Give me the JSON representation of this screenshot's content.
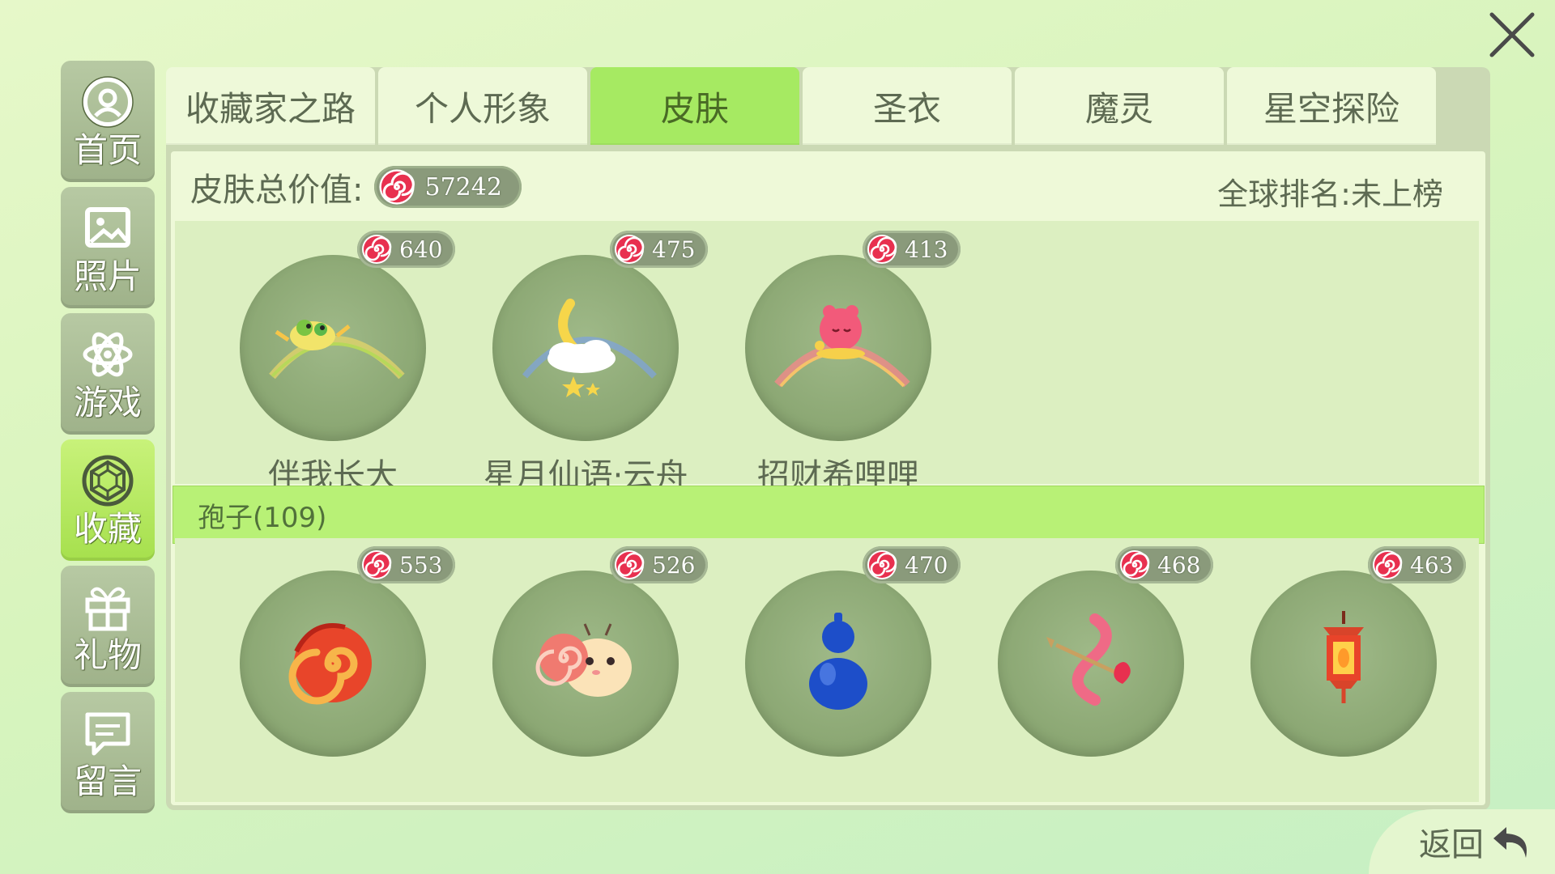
{
  "colors": {
    "accent_green": "#a6ea62",
    "panel_bg": "#eef9d8",
    "coin_red": "#e8304f"
  },
  "close": {
    "icon": "close-icon"
  },
  "sidebar": {
    "items": [
      {
        "label": "首页",
        "icon": "home-user-icon",
        "active": false
      },
      {
        "label": "照片",
        "icon": "photo-icon",
        "active": false
      },
      {
        "label": "游戏",
        "icon": "atom-icon",
        "active": false
      },
      {
        "label": "收藏",
        "icon": "gem-icon",
        "active": true
      },
      {
        "label": "礼物",
        "icon": "gift-icon",
        "active": false
      },
      {
        "label": "留言",
        "icon": "message-icon",
        "active": false
      }
    ]
  },
  "tabs": [
    {
      "label": "收藏家之路",
      "active": false
    },
    {
      "label": "个人形象",
      "active": false
    },
    {
      "label": "皮肤",
      "active": true
    },
    {
      "label": "圣衣",
      "active": false
    },
    {
      "label": "魔灵",
      "active": false
    },
    {
      "label": "星空探险",
      "active": false
    }
  ],
  "summary": {
    "label": "皮肤总价值:",
    "total": "57242",
    "ranking_label": "全球排名:",
    "ranking_value": "未上榜"
  },
  "top_items": [
    {
      "name": "伴我长大",
      "price": "640",
      "icon": "grow-with-me-skin-icon"
    },
    {
      "name": "星月仙语·云舟",
      "price": "475",
      "icon": "moon-cloud-boat-skin-icon"
    },
    {
      "name": "招财希哩哩",
      "price": "413",
      "icon": "lucky-pink-creature-skin-icon"
    }
  ],
  "section": {
    "label": "孢子(109)"
  },
  "bottom_items": [
    {
      "price": "553",
      "icon": "fire-swirl-spore-icon"
    },
    {
      "price": "526",
      "icon": "snail-spore-icon"
    },
    {
      "price": "470",
      "icon": "blue-gourd-spore-icon"
    },
    {
      "price": "468",
      "icon": "cupid-arrow-spore-icon"
    },
    {
      "price": "463",
      "icon": "lantern-spore-icon"
    }
  ],
  "back": {
    "label": "返回",
    "icon": "return-arrow-icon"
  }
}
